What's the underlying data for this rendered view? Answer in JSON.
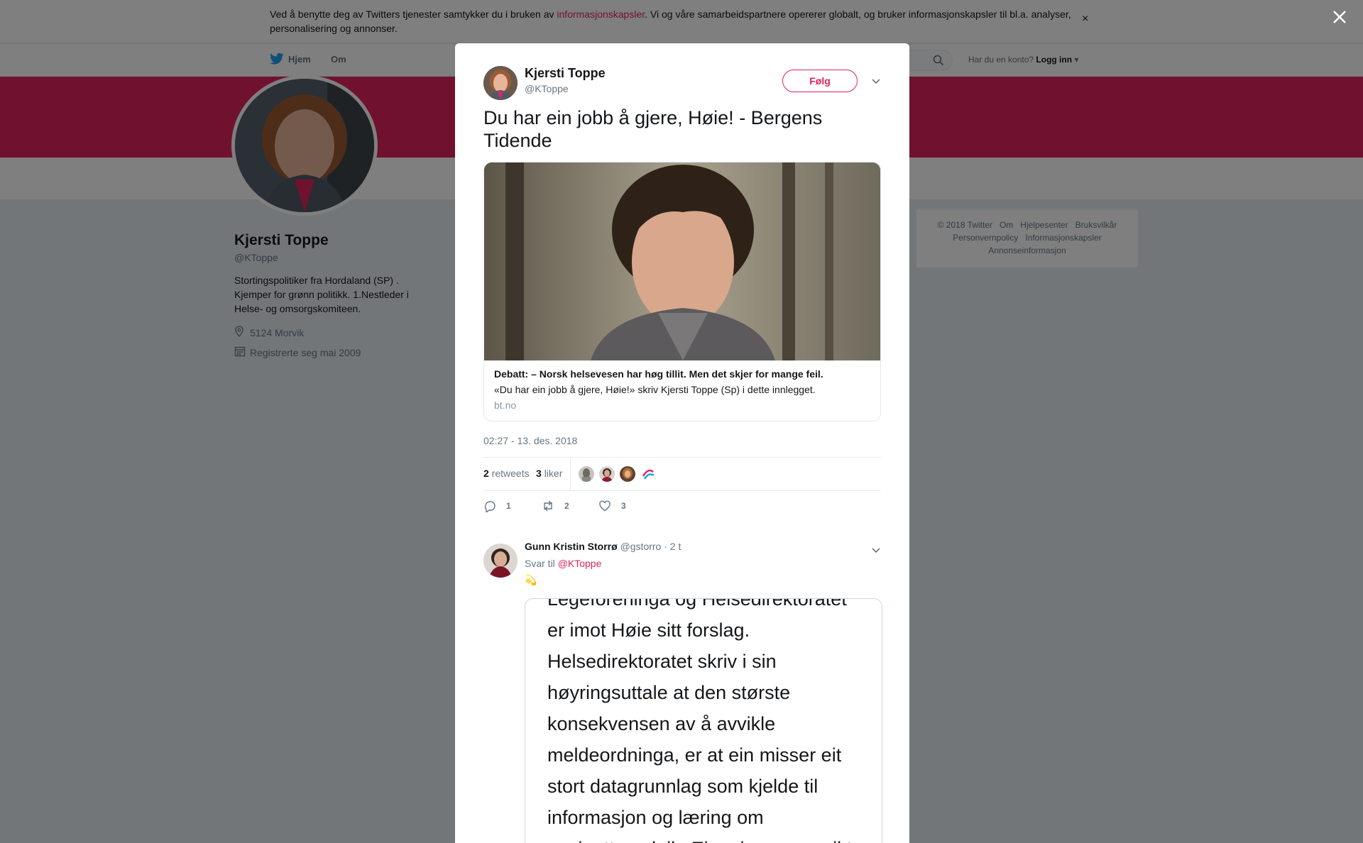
{
  "cookie_bar": {
    "text_before": "Ved å benytte deg av Twitters tjenester samtykker du i bruken av ",
    "link": "informasjonskapsler",
    "text_after": ". Vi og våre samarbeidspartnere opererer globalt, og bruker informasjonskapsler til bl.a. analyser, personalisering og annonser.",
    "close": "×"
  },
  "nav": {
    "home": "Hjem",
    "about": "Om",
    "login_prompt": "Har du en konto?",
    "login": "Logg inn"
  },
  "profile": {
    "name": "Kjersti Toppe",
    "handle": "@KToppe",
    "bio": "Stortingspolitiker fra Hordaland (SP) . Kjemper for grønn politikk. 1.Nestleder i Helse- og omsorgskomiteen.",
    "location": "5124 Morvik",
    "joined": "Registrerte seg mai 2009"
  },
  "footer": {
    "links": [
      "© 2018 Twitter",
      "Om",
      "Hjelpesenter",
      "Bruksvilkår",
      "Personvernpolicy",
      "Informasjonskapsler",
      "Annonseinformasjon"
    ]
  },
  "tweet": {
    "author_name": "Kjersti Toppe",
    "author_handle": "@KToppe",
    "follow_label": "Følg",
    "text": "Du har ein jobb å gjere, Høie! - Bergens Tidende",
    "card": {
      "title": "Debatt: – Norsk helsevesen har høg tillit. Men det skjer for mange feil.",
      "description": "«Du har ein jobb å gjere, Høie!» skriv Kjersti Toppe (Sp) i dette innlegget.",
      "domain": "bt.no"
    },
    "timestamp": "02:27 - 13. des. 2018",
    "retweets_count": "2",
    "retweets_label": "retweets",
    "likes_count": "3",
    "likes_label": "liker",
    "replies": "1",
    "retweets": "2",
    "likes": "3"
  },
  "reply": {
    "author_name": "Gunn Kristin Storrø",
    "author_handle": "@gstorro",
    "time": "· 2 t",
    "reply_to_label": "Svar til",
    "reply_to_handle": "@KToppe",
    "emoji": "💫",
    "image_lines": [
      "Legeforeninga og Helsedirektoratet",
      "er imot Høie sitt forslag.",
      "Helsedirektoratet skriv i sin",
      "høyringsuttale at den største",
      "konsekvensen av å avvikle",
      "meldeordninga, er at ein misser eit",
      "stort datagrunnlag som kjelde til",
      "informasjon og læring om",
      "pasienttryggleik. Ein misser oversikt"
    ]
  },
  "colors": {
    "accent": "#e0245e",
    "banner": "#e0245e",
    "text": "#14171a",
    "secondary": "#657786",
    "background": "#e6ecf0"
  }
}
